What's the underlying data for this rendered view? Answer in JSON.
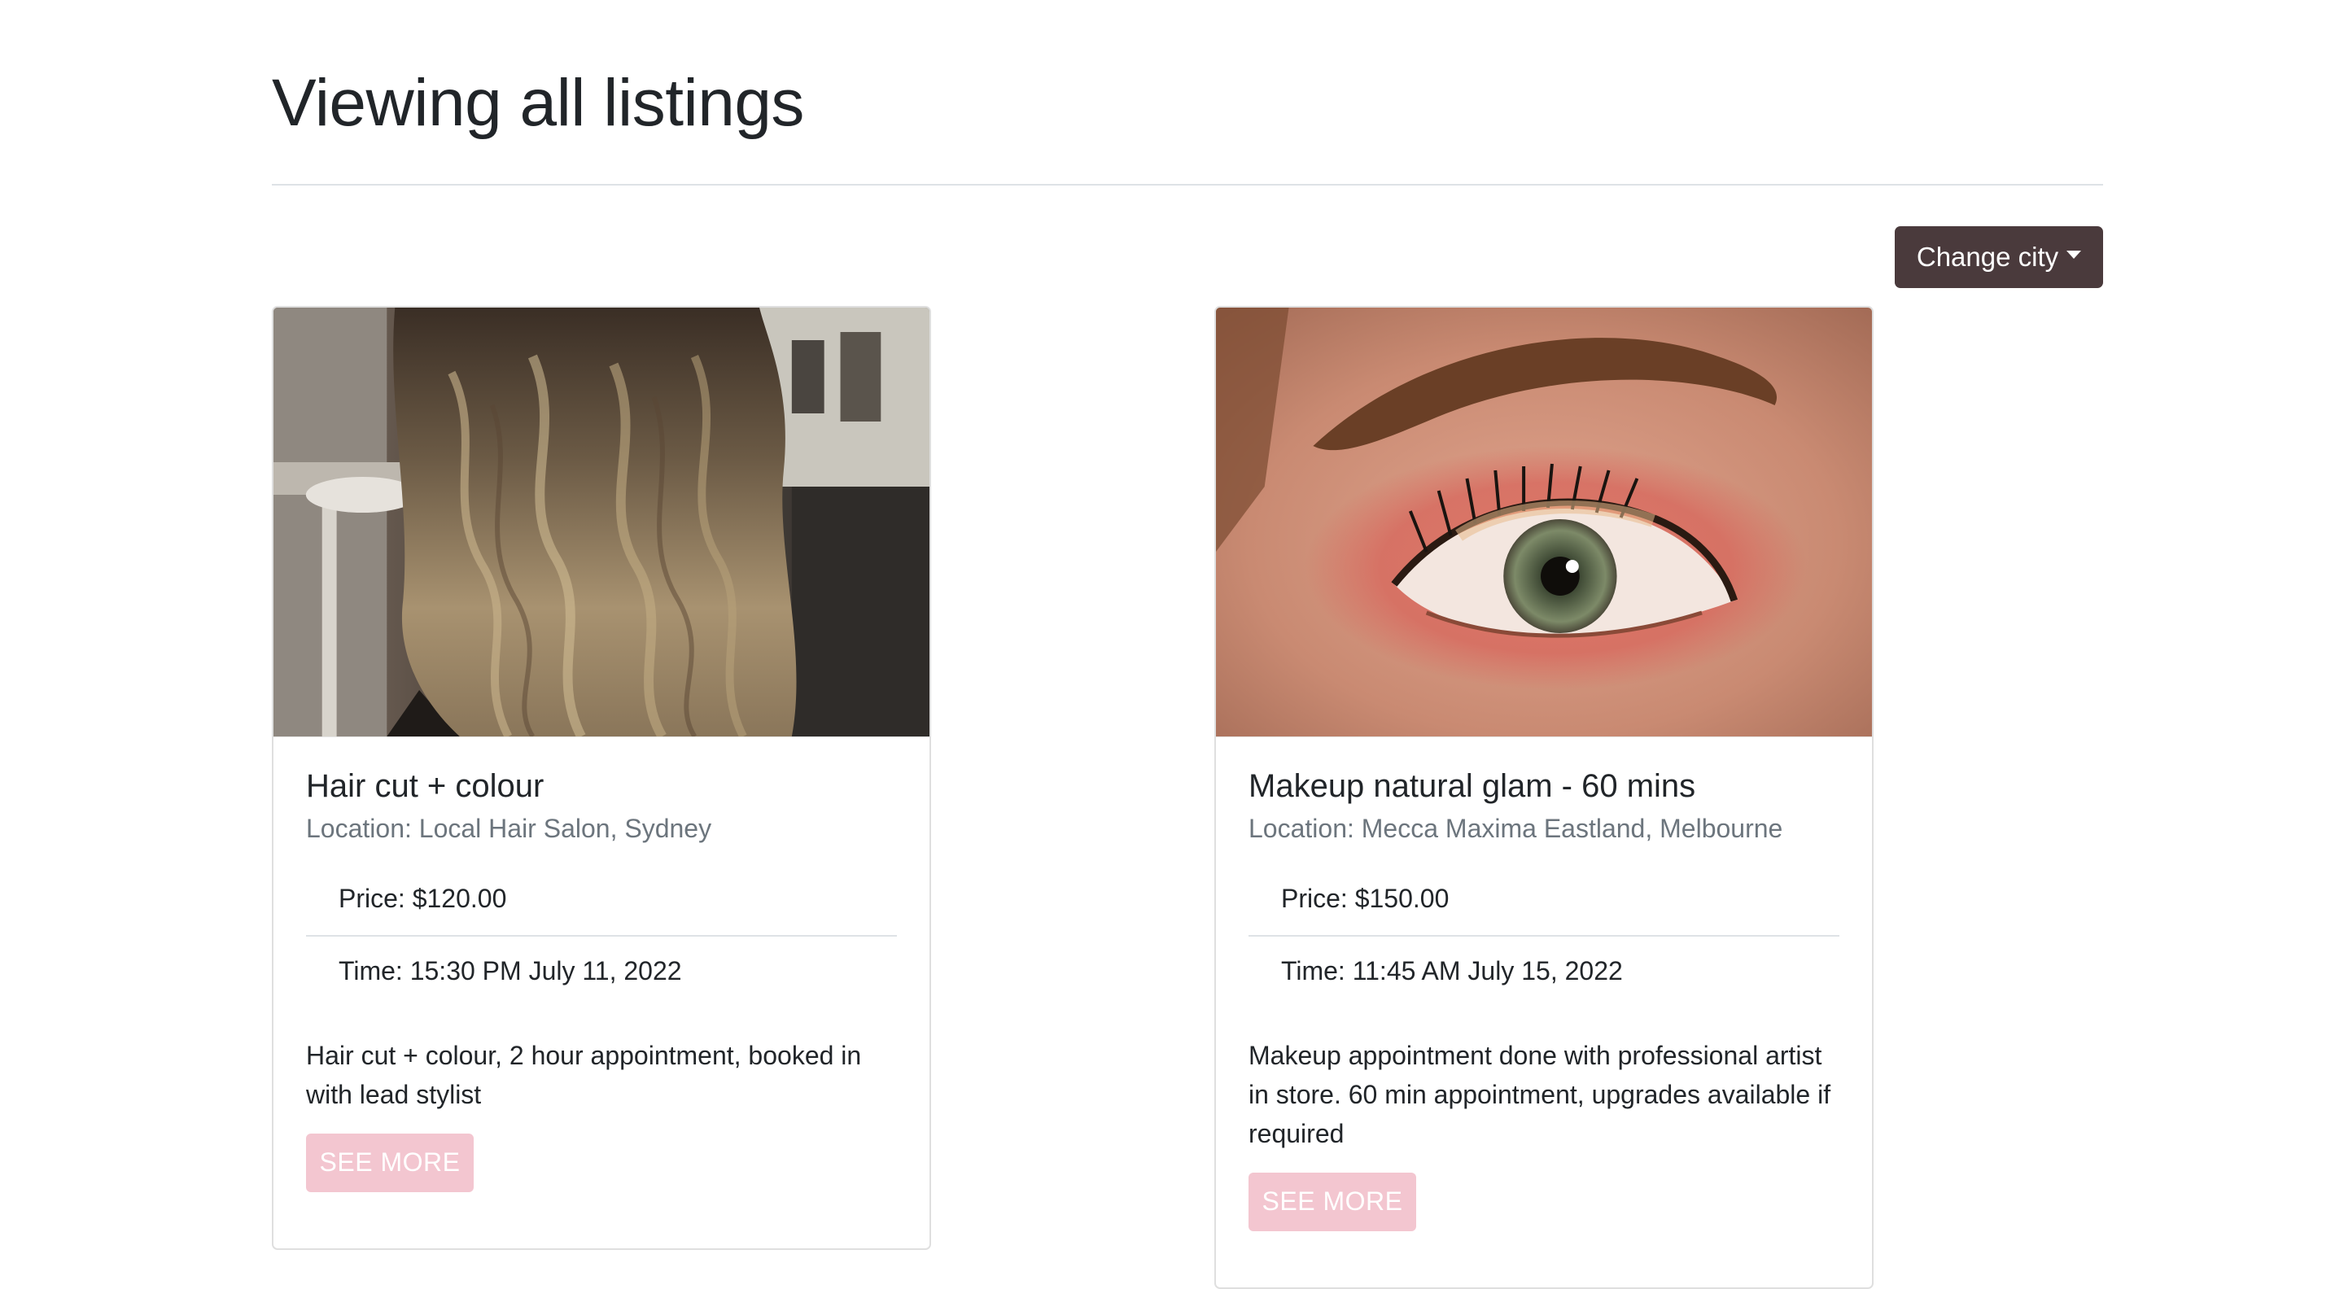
{
  "page": {
    "title": "Viewing all listings"
  },
  "controls": {
    "change_city_label": "Change city"
  },
  "colors": {
    "primary_button": "#4a3a3c",
    "see_more_button": "#f3c6d0",
    "muted_text": "#6c757d"
  },
  "listings": [
    {
      "image": "photo of long wavy balayage hair in a salon",
      "title": "Hair cut + colour",
      "location": "Location: Local Hair Salon, Sydney",
      "price": "Price: $120.00",
      "time": "Time: 15:30 PM July 11, 2022",
      "description": "Hair cut + colour, 2 hour appointment, booked in with lead stylist",
      "button_label": "SEE MORE"
    },
    {
      "image": "close-up photo of an eye with pink eyeshadow makeup",
      "title": "Makeup natural glam - 60 mins",
      "location": "Location: Mecca Maxima Eastland, Melbourne",
      "price": "Price: $150.00",
      "time": "Time: 11:45 AM July 15, 2022",
      "description": "Makeup appointment done with professional artist in store. 60 min appointment, upgrades available if required",
      "button_label": "SEE MORE"
    }
  ]
}
